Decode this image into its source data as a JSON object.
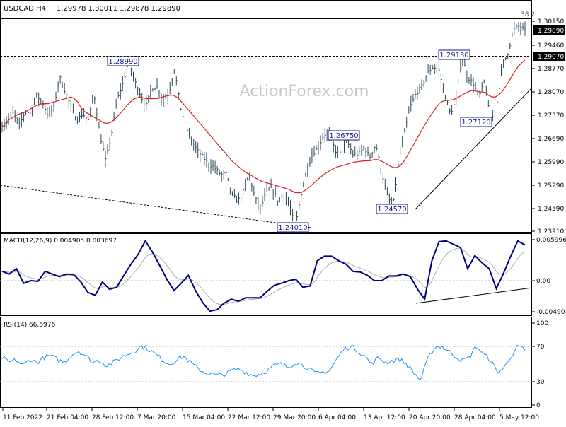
{
  "header": {
    "symbol": "USDCAD,H4",
    "ohlc": "1.29978 1.30011 1.29878 1.29890"
  },
  "watermark": "ActionForex.com",
  "price_axis": {
    "ticks": [
      "1.30150",
      "1.29460",
      "1.28770",
      "1.28070",
      "1.27370",
      "1.26690",
      "1.25990",
      "1.25290",
      "1.24590",
      "1.23910"
    ],
    "current_price": "1.29890",
    "line_price": "1.29070"
  },
  "macd_panel": {
    "label": "MACD(12,26,9) 0.004905 0.003697",
    "ticks": [
      "0.005996",
      "0.00",
      "-0.004901"
    ]
  },
  "rsi_panel": {
    "label": "RSI(14) 66.6976",
    "ticks": [
      "100",
      "70",
      "30",
      "0"
    ]
  },
  "time_axis": {
    "labels": [
      "11 Feb 2022",
      "21 Feb 04:00",
      "28 Feb 12:00",
      "7 Mar 20:00",
      "15 Mar 04:00",
      "22 Mar 12:00",
      "29 Mar 20:00",
      "6 Apr 04:00",
      "13 Apr 12:00",
      "20 Apr 20:00",
      "28 Apr 04:00",
      "5 May 12:00"
    ]
  },
  "annotations": {
    "labels": [
      "1.28990",
      "1.26750",
      "1.29130",
      "1.27120",
      "1.24570",
      "1.24010",
      "38.2"
    ]
  },
  "colors": {
    "bars": "#2e4a5a",
    "ma": "#d42020",
    "macd": "#00007f",
    "signal": "#b0b0b0",
    "rsi": "#1e90ff",
    "label_fill": "#1a1a8a",
    "price_tag": "#000000"
  },
  "chart_data": [
    {
      "type": "bar",
      "title": "USDCAD,H4",
      "series_type": "ohlc",
      "x": [
        "11 Feb 2022",
        "21 Feb 04:00",
        "28 Feb 12:00",
        "7 Mar 20:00",
        "15 Mar 04:00",
        "22 Mar 12:00",
        "29 Mar 20:00",
        "6 Apr 04:00",
        "13 Apr 12:00",
        "20 Apr 20:00",
        "28 Apr 04:00",
        "5 May 12:00"
      ],
      "price_path": [
        1.27,
        1.272,
        1.2745,
        1.2705,
        1.2748,
        1.274,
        1.2795,
        1.2775,
        1.2735,
        1.276,
        1.285,
        1.2805,
        1.276,
        1.272,
        1.274,
        1.272,
        1.28,
        1.268,
        1.26,
        1.2675,
        1.278,
        1.283,
        1.2899,
        1.284,
        1.28,
        1.276,
        1.2815,
        1.282,
        1.278,
        1.28,
        1.2875,
        1.276,
        1.27,
        1.266,
        1.263,
        1.261,
        1.259,
        1.258,
        1.256,
        1.256,
        1.25,
        1.248,
        1.251,
        1.256,
        1.249,
        1.246,
        1.251,
        1.252,
        1.248,
        1.25,
        1.247,
        1.2401,
        1.25,
        1.257,
        1.262,
        1.264,
        1.268,
        1.2675,
        1.263,
        1.262,
        1.266,
        1.262,
        1.262,
        1.264,
        1.261,
        1.265,
        1.257,
        1.25,
        1.2457,
        1.26,
        1.268,
        1.276,
        1.28,
        1.282,
        1.286,
        1.288,
        1.287,
        1.28,
        1.274,
        1.278,
        1.2913,
        1.285,
        1.283,
        1.279,
        1.284,
        1.2712,
        1.276,
        1.288,
        1.292,
        1.299,
        1.3001,
        1.2989
      ],
      "moving_average_path": [
        1.27,
        1.272,
        1.273,
        1.274,
        1.2745,
        1.2755,
        1.2765,
        1.277,
        1.277,
        1.2775,
        1.278,
        1.2785,
        1.279,
        1.278,
        1.275,
        1.274,
        1.273,
        1.272,
        1.271,
        1.2715,
        1.273,
        1.275,
        1.277,
        1.2785,
        1.279,
        1.2785,
        1.2785,
        1.2785,
        1.279,
        1.2795,
        1.2795,
        1.278,
        1.276,
        1.274,
        1.272,
        1.27,
        1.268,
        1.266,
        1.264,
        1.262,
        1.26,
        1.2585,
        1.257,
        1.256,
        1.255,
        1.254,
        1.2535,
        1.253,
        1.2525,
        1.252,
        1.2515,
        1.2505,
        1.2505,
        1.2515,
        1.253,
        1.2545,
        1.256,
        1.257,
        1.258,
        1.2585,
        1.259,
        1.2595,
        1.2598,
        1.26,
        1.26,
        1.2605,
        1.26,
        1.259,
        1.258,
        1.258,
        1.26,
        1.263,
        1.266,
        1.269,
        1.272,
        1.2745,
        1.277,
        1.278,
        1.278,
        1.2785,
        1.2795,
        1.2805,
        1.281,
        1.2805,
        1.2805,
        1.279,
        1.279,
        1.2805,
        1.283,
        1.286,
        1.2885,
        1.29
      ],
      "ylim": [
        1.2391,
        1.3015
      ],
      "horizontal_levels": [
        1.3015,
        1.2989,
        1.2907
      ],
      "annotated_levels": [
        1.2899,
        1.2675,
        1.2913,
        1.2712,
        1.2457,
        1.2401
      ]
    },
    {
      "type": "line",
      "title": "MACD(12,26,9) 0.004905 0.003697",
      "series": [
        {
          "name": "MACD",
          "values": [
            0.0012,
            0.0008,
            0.0016,
            -0.0006,
            -0.0002,
            -0.0003,
            0.0012,
            0.0008,
            0.0004,
            0.0008,
            0.0007,
            -0.0004,
            -0.002,
            -0.0024,
            -0.0004,
            -0.0015,
            -0.0012,
            0.0006,
            0.0023,
            0.0038,
            0.0058,
            0.0041,
            0.0021,
            0.0,
            -0.0017,
            -0.0006,
            0.0006,
            -0.0017,
            -0.0035,
            -0.0048,
            -0.0046,
            -0.0036,
            -0.003,
            -0.0033,
            -0.0028,
            -0.0028,
            -0.0028,
            -0.0018,
            -0.0009,
            -0.0006,
            -0.0002,
            0.0,
            -0.0012,
            -0.001,
            0.0028,
            0.0035,
            0.0035,
            0.0028,
            0.0023,
            0.0012,
            0.0011,
            0.0006,
            -0.0002,
            -0.0002,
            0.0005,
            0.0005,
            0.0008,
            0.0004,
            -0.0015,
            -0.003,
            0.0028,
            0.0057,
            0.0058,
            0.0053,
            0.0048,
            0.0016,
            0.0036,
            0.0025,
            0.0016,
            -0.0014,
            0.0009,
            0.0035,
            0.0058,
            0.0052
          ]
        }
      ],
      "ylim": [
        -0.004901,
        0.005996
      ],
      "trendline": true
    },
    {
      "type": "line",
      "title": "RSI(14) 66.6976",
      "series": [
        {
          "name": "RSI(14)",
          "values": [
            58,
            52,
            55,
            48,
            56,
            52,
            58,
            60,
            55,
            52,
            62,
            66,
            60,
            52,
            55,
            48,
            52,
            58,
            62,
            66,
            72,
            68,
            62,
            55,
            50,
            55,
            60,
            52,
            45,
            40,
            38,
            36,
            38,
            42,
            44,
            40,
            36,
            38,
            42,
            48,
            50,
            46,
            52,
            50,
            44,
            38,
            40,
            42,
            56,
            68,
            72,
            66,
            60,
            50,
            58,
            52,
            54,
            56,
            50,
            40,
            30,
            55,
            70,
            72,
            66,
            60,
            54,
            58,
            72,
            62,
            56,
            40,
            45,
            60,
            72,
            66.7
          ]
        }
      ],
      "ylim": [
        0,
        100
      ],
      "levels": [
        70,
        30
      ]
    }
  ]
}
